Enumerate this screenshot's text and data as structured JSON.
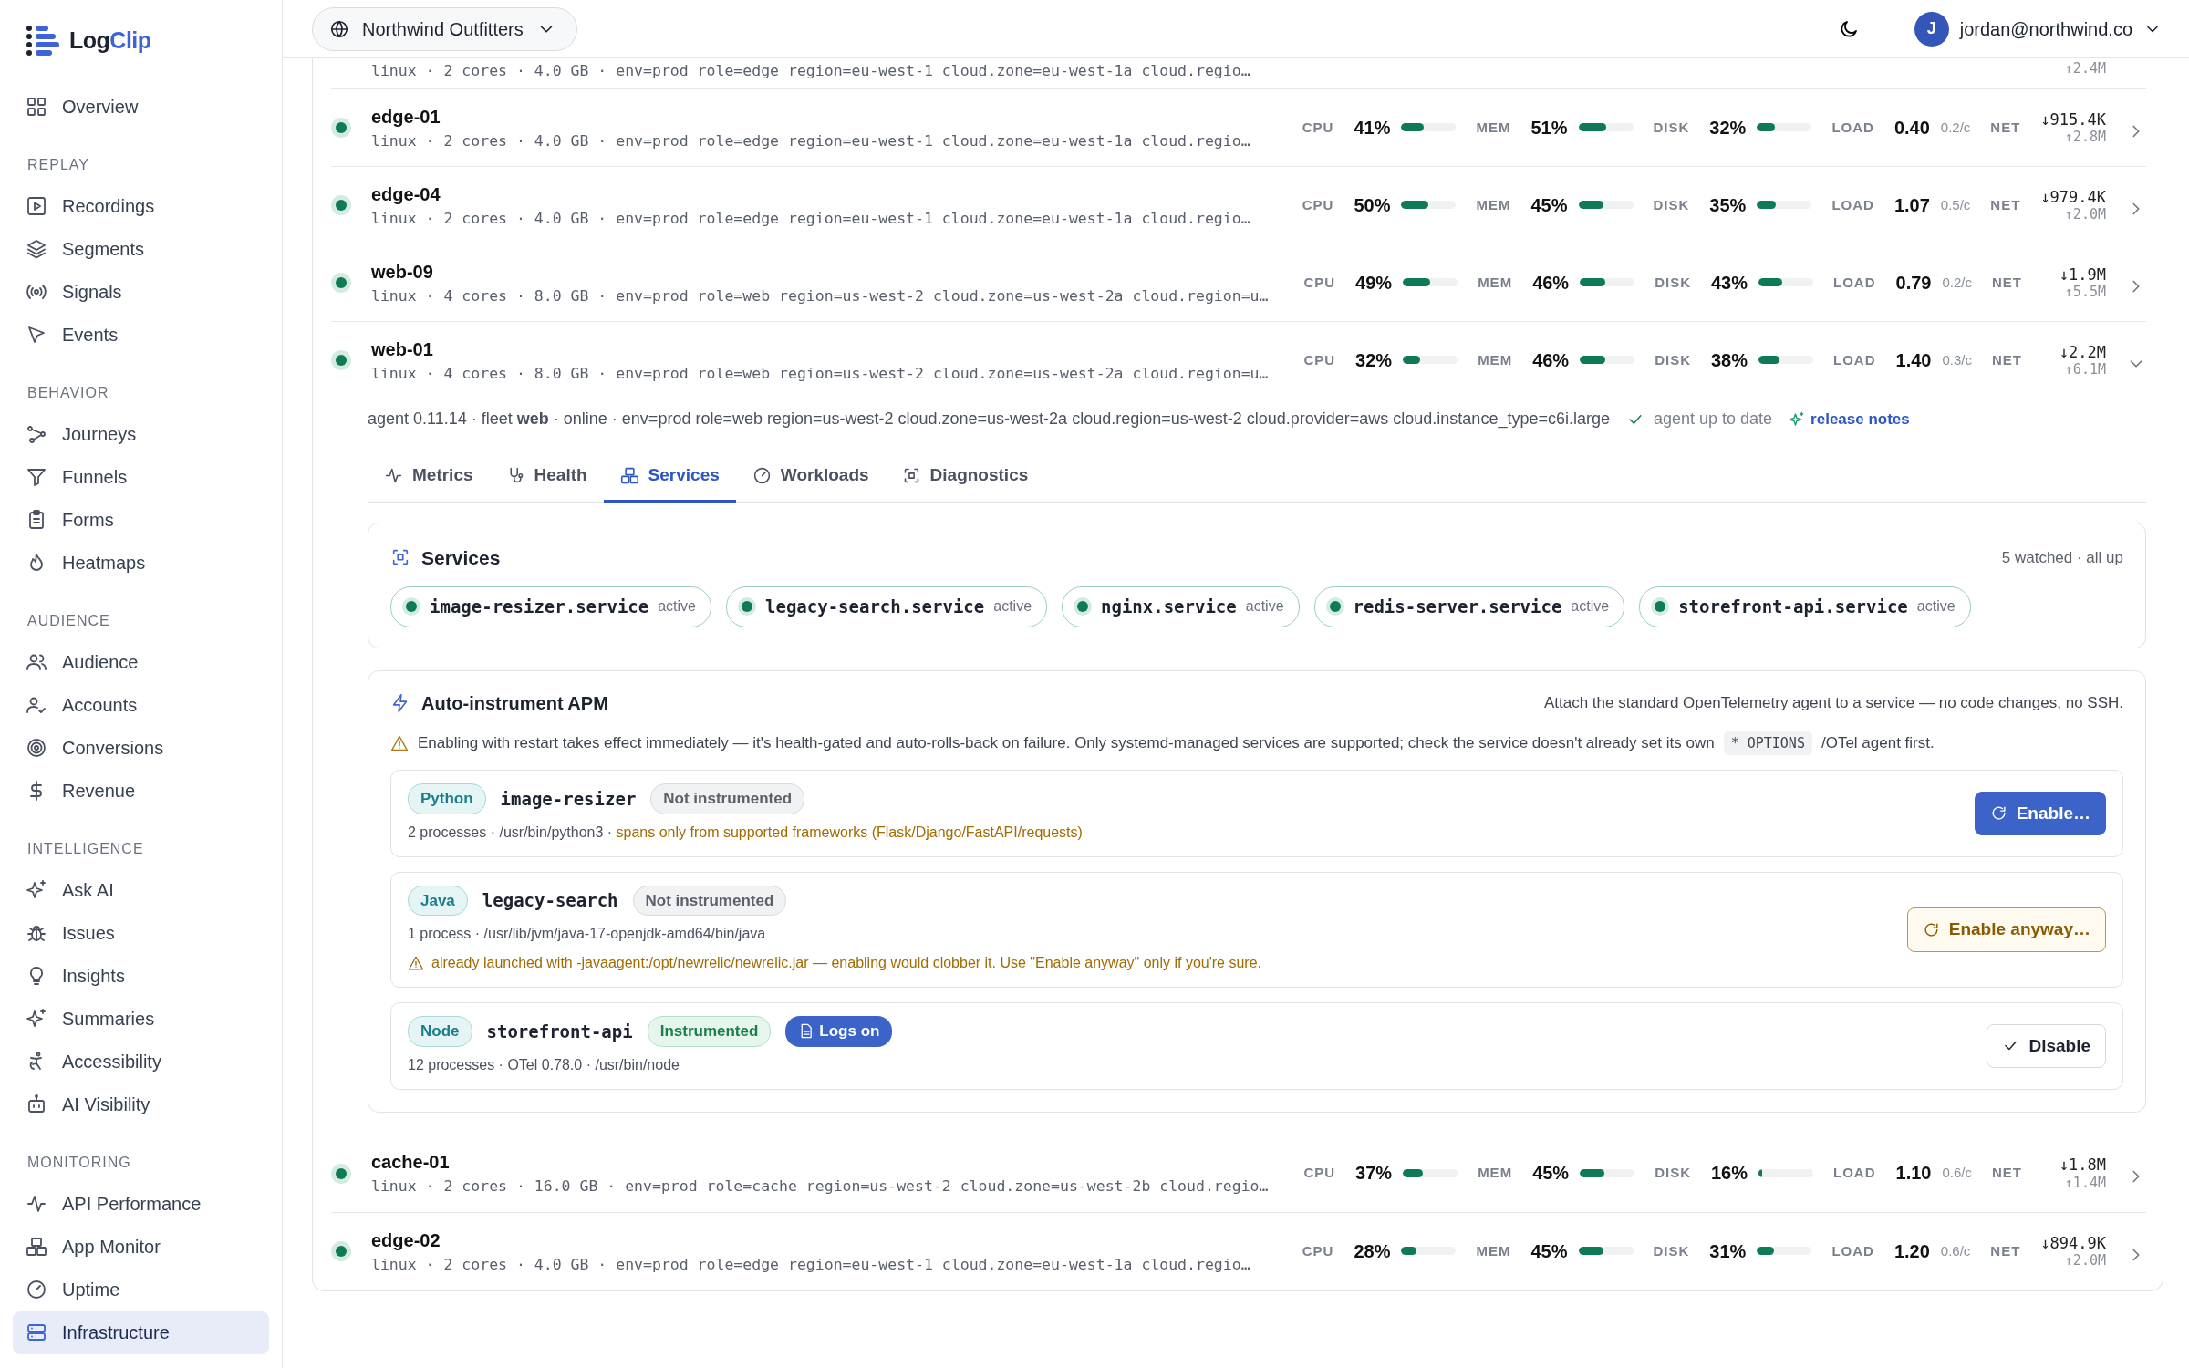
{
  "sidebar": {
    "brand_first": "Log",
    "brand_second": "Clip",
    "top_items": [
      {
        "label": "Overview",
        "selected": false
      }
    ],
    "sections": [
      {
        "title": "REPLAY",
        "items": [
          {
            "label": "Recordings",
            "selected": false
          },
          {
            "label": "Segments",
            "selected": false
          },
          {
            "label": "Signals",
            "selected": false
          },
          {
            "label": "Events",
            "selected": false
          }
        ]
      },
      {
        "title": "BEHAVIOR",
        "items": [
          {
            "label": "Journeys",
            "selected": false
          },
          {
            "label": "Funnels",
            "selected": false
          },
          {
            "label": "Forms",
            "selected": false
          },
          {
            "label": "Heatmaps",
            "selected": false
          }
        ]
      },
      {
        "title": "AUDIENCE",
        "items": [
          {
            "label": "Audience",
            "selected": false
          },
          {
            "label": "Accounts",
            "selected": false
          },
          {
            "label": "Conversions",
            "selected": false
          },
          {
            "label": "Revenue",
            "selected": false
          }
        ]
      },
      {
        "title": "INTELLIGENCE",
        "items": [
          {
            "label": "Ask AI",
            "selected": false
          },
          {
            "label": "Issues",
            "selected": false
          },
          {
            "label": "Insights",
            "selected": false
          },
          {
            "label": "Summaries",
            "selected": false
          },
          {
            "label": "Accessibility",
            "selected": false
          },
          {
            "label": "AI Visibility",
            "selected": false
          }
        ]
      },
      {
        "title": "MONITORING",
        "items": [
          {
            "label": "API Performance",
            "selected": false
          },
          {
            "label": "App Monitor",
            "selected": false
          },
          {
            "label": "Uptime",
            "selected": false
          },
          {
            "label": "Infrastructure",
            "selected": true
          }
        ]
      }
    ]
  },
  "topbar": {
    "org": "Northwind Outfitters",
    "avatar": "J",
    "user": "jordan@northwind.co"
  },
  "cut_row": {
    "meta": "linux · 2 cores · 4.0 GB · env=prod role=edge region=eu-west-1 cloud.zone=eu-west-1a cloud.regio…",
    "net_up": "↑2.4M"
  },
  "hosts": [
    {
      "name": "edge-01",
      "online": true,
      "expanded": false,
      "meta": "linux · 2 cores · 4.0 GB · env=prod role=edge region=eu-west-1 cloud.zone=eu-west-1a cloud.regio…",
      "metrics": [
        {
          "label": "CPU",
          "value": "41%",
          "level": 0.41
        },
        {
          "label": "MEM",
          "value": "51%",
          "level": 0.51
        },
        {
          "label": "DISK",
          "value": "32%",
          "level": 0.32
        }
      ],
      "load": {
        "label": "LOAD",
        "value": "0.40",
        "per_core": "0.2/c"
      },
      "net": {
        "label": "NET",
        "down": "↓915.4K",
        "up": "↑2.8M"
      }
    },
    {
      "name": "edge-04",
      "online": true,
      "expanded": false,
      "meta": "linux · 2 cores · 4.0 GB · env=prod role=edge region=eu-west-1 cloud.zone=eu-west-1a cloud.regio…",
      "metrics": [
        {
          "label": "CPU",
          "value": "50%",
          "level": 0.5
        },
        {
          "label": "MEM",
          "value": "45%",
          "level": 0.45
        },
        {
          "label": "DISK",
          "value": "35%",
          "level": 0.35
        }
      ],
      "load": {
        "label": "LOAD",
        "value": "1.07",
        "per_core": "0.5/c"
      },
      "net": {
        "label": "NET",
        "down": "↓979.4K",
        "up": "↑2.0M"
      }
    },
    {
      "name": "web-09",
      "online": true,
      "expanded": false,
      "meta": "linux · 4 cores · 8.0 GB · env=prod role=web region=us-west-2 cloud.zone=us-west-2a cloud.region=u…",
      "metrics": [
        {
          "label": "CPU",
          "value": "49%",
          "level": 0.49
        },
        {
          "label": "MEM",
          "value": "46%",
          "level": 0.46
        },
        {
          "label": "DISK",
          "value": "43%",
          "level": 0.43
        }
      ],
      "load": {
        "label": "LOAD",
        "value": "0.79",
        "per_core": "0.2/c"
      },
      "net": {
        "label": "NET",
        "down": "↓1.9M",
        "up": "↑5.5M"
      }
    },
    {
      "name": "web-01",
      "online": true,
      "expanded": true,
      "meta": "linux · 4 cores · 8.0 GB · env=prod role=web region=us-west-2 cloud.zone=us-west-2a cloud.region=u…",
      "metrics": [
        {
          "label": "CPU",
          "value": "32%",
          "level": 0.32
        },
        {
          "label": "MEM",
          "value": "46%",
          "level": 0.46
        },
        {
          "label": "DISK",
          "value": "38%",
          "level": 0.38
        }
      ],
      "load": {
        "label": "LOAD",
        "value": "1.40",
        "per_core": "0.3/c"
      },
      "net": {
        "label": "NET",
        "down": "↓2.2M",
        "up": "↑6.1M"
      },
      "detail": {
        "agent_line": "agent 0.11.14 · fleet **web** · online · env=prod role=web region=us-west-2 cloud.zone=us-west-2a cloud.region=us-west-2 cloud.provider=aws cloud.instance_type=c6i.large",
        "agent_status": "agent up to date",
        "release_link": "release notes",
        "tabs": [
          {
            "label": "Metrics",
            "selected": false
          },
          {
            "label": "Health",
            "selected": false
          },
          {
            "label": "Services",
            "selected": true
          },
          {
            "label": "Workloads",
            "selected": false
          },
          {
            "label": "Diagnostics",
            "selected": false
          }
        ],
        "services": {
          "title": "Services",
          "summary": "5 watched · all up",
          "items": [
            {
              "name": "image-resizer.service",
              "status": "active"
            },
            {
              "name": "legacy-search.service",
              "status": "active"
            },
            {
              "name": "nginx.service",
              "status": "active"
            },
            {
              "name": "redis-server.service",
              "status": "active"
            },
            {
              "name": "storefront-api.service",
              "status": "active"
            }
          ]
        },
        "apm": {
          "title": "Auto-instrument APM",
          "subtitle": "Attach the standard OpenTelemetry agent to a service — no code changes, no SSH.",
          "warning_before": "Enabling with restart takes effect immediately — it's health-gated and auto-rolls-back on failure. Only systemd-managed services are supported; check the service doesn't already set its own",
          "warning_code": "*_OPTIONS",
          "warning_after": "/OTel agent first.",
          "items": [
            {
              "language": "Python",
              "name": "image-resizer",
              "status": "Not instrumented",
              "instrumented": false,
              "detail": "2 processes · /usr/bin/python3 ·",
              "note": "spans only from supported frameworks (Flask/Django/FastAPI/requests)",
              "action": {
                "kind": "primary",
                "label": "Enable…"
              }
            },
            {
              "language": "Java",
              "name": "legacy-search",
              "status": "Not instrumented",
              "instrumented": false,
              "detail": "1 process · /usr/lib/jvm/java-17-openjdk-amd64/bin/java",
              "warning": "already launched with -javaagent:/opt/newrelic/newrelic.jar — enabling would clobber it. Use \"Enable anyway\" only if you're sure.",
              "action": {
                "kind": "warning",
                "label": "Enable anyway…"
              }
            },
            {
              "language": "Node",
              "name": "storefront-api",
              "status": "Instrumented",
              "instrumented": true,
              "logs_badge": "Logs on",
              "detail": "12 processes · OTel 0.78.0 · /usr/bin/node",
              "action": {
                "kind": "outline",
                "label": "Disable"
              }
            }
          ]
        }
      }
    },
    {
      "name": "cache-01",
      "online": true,
      "expanded": false,
      "meta": "linux · 2 cores · 16.0 GB · env=prod role=cache region=us-west-2 cloud.zone=us-west-2b cloud.regio…",
      "metrics": [
        {
          "label": "CPU",
          "value": "37%",
          "level": 0.37
        },
        {
          "label": "MEM",
          "value": "45%",
          "level": 0.45
        },
        {
          "label": "DISK",
          "value": "16%",
          "level": 0.06
        }
      ],
      "load": {
        "label": "LOAD",
        "value": "1.10",
        "per_core": "0.6/c"
      },
      "net": {
        "label": "NET",
        "down": "↓1.8M",
        "up": "↑1.4M"
      }
    },
    {
      "name": "edge-02",
      "online": true,
      "expanded": false,
      "meta": "linux · 2 cores · 4.0 GB · env=prod role=edge region=eu-west-1 cloud.zone=eu-west-1a cloud.regio…",
      "metrics": [
        {
          "label": "CPU",
          "value": "28%",
          "level": 0.28
        },
        {
          "label": "MEM",
          "value": "45%",
          "level": 0.45
        },
        {
          "label": "DISK",
          "value": "31%",
          "level": 0.31
        }
      ],
      "load": {
        "label": "LOAD",
        "value": "1.20",
        "per_core": "0.6/c"
      },
      "net": {
        "label": "NET",
        "down": "↓894.9K",
        "up": "↑2.0M"
      }
    }
  ]
}
